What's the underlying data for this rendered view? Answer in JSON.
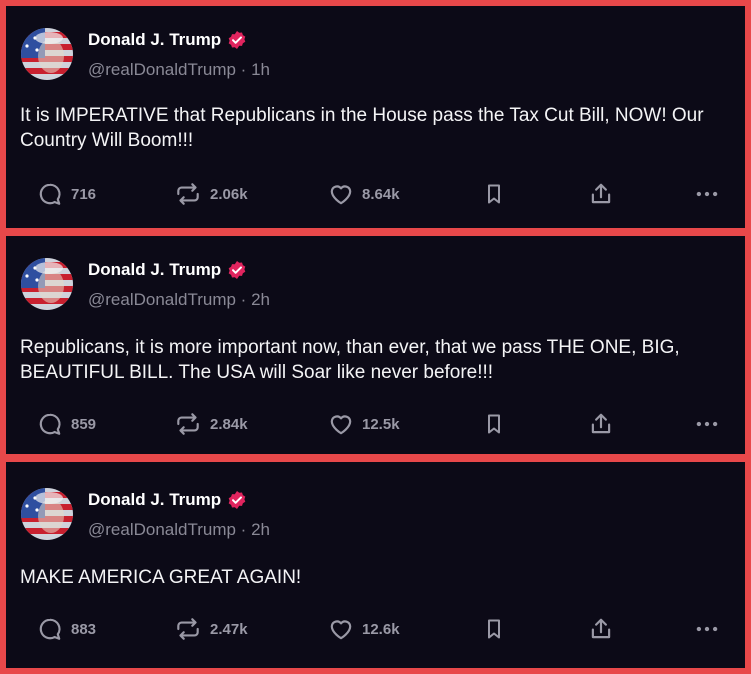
{
  "icons": {
    "reply": "speech-bubble-icon",
    "repost": "repost-arrows-icon",
    "like": "heart-icon",
    "bookmark": "bookmark-icon",
    "share": "share-upload-icon",
    "more": "more-dots-icon",
    "verified": "verified-badge-icon"
  },
  "colors": {
    "verified": "#e0245e",
    "background": "#0c0a17",
    "frame": "#e8484a"
  },
  "posts": [
    {
      "author": "Donald J. Trump",
      "handle_time": "@realDonaldTrump · 1h",
      "text": "It is IMPERATIVE that Republicans in the House pass the Tax Cut Bill, NOW! Our Country Will Boom!!!",
      "replies": "716",
      "reposts": "2.06k",
      "likes": "8.64k"
    },
    {
      "author": "Donald J. Trump",
      "handle_time": "@realDonaldTrump · 2h",
      "text": "Republicans, it is more important now, than ever, that we pass THE ONE, BIG, BEAUTIFUL BILL. The USA will Soar like never before!!!",
      "replies": "859",
      "reposts": "2.84k",
      "likes": "12.5k"
    },
    {
      "author": "Donald J. Trump",
      "handle_time": "@realDonaldTrump · 2h",
      "text": "MAKE AMERICA GREAT AGAIN!",
      "replies": "883",
      "reposts": "2.47k",
      "likes": "12.6k"
    }
  ]
}
